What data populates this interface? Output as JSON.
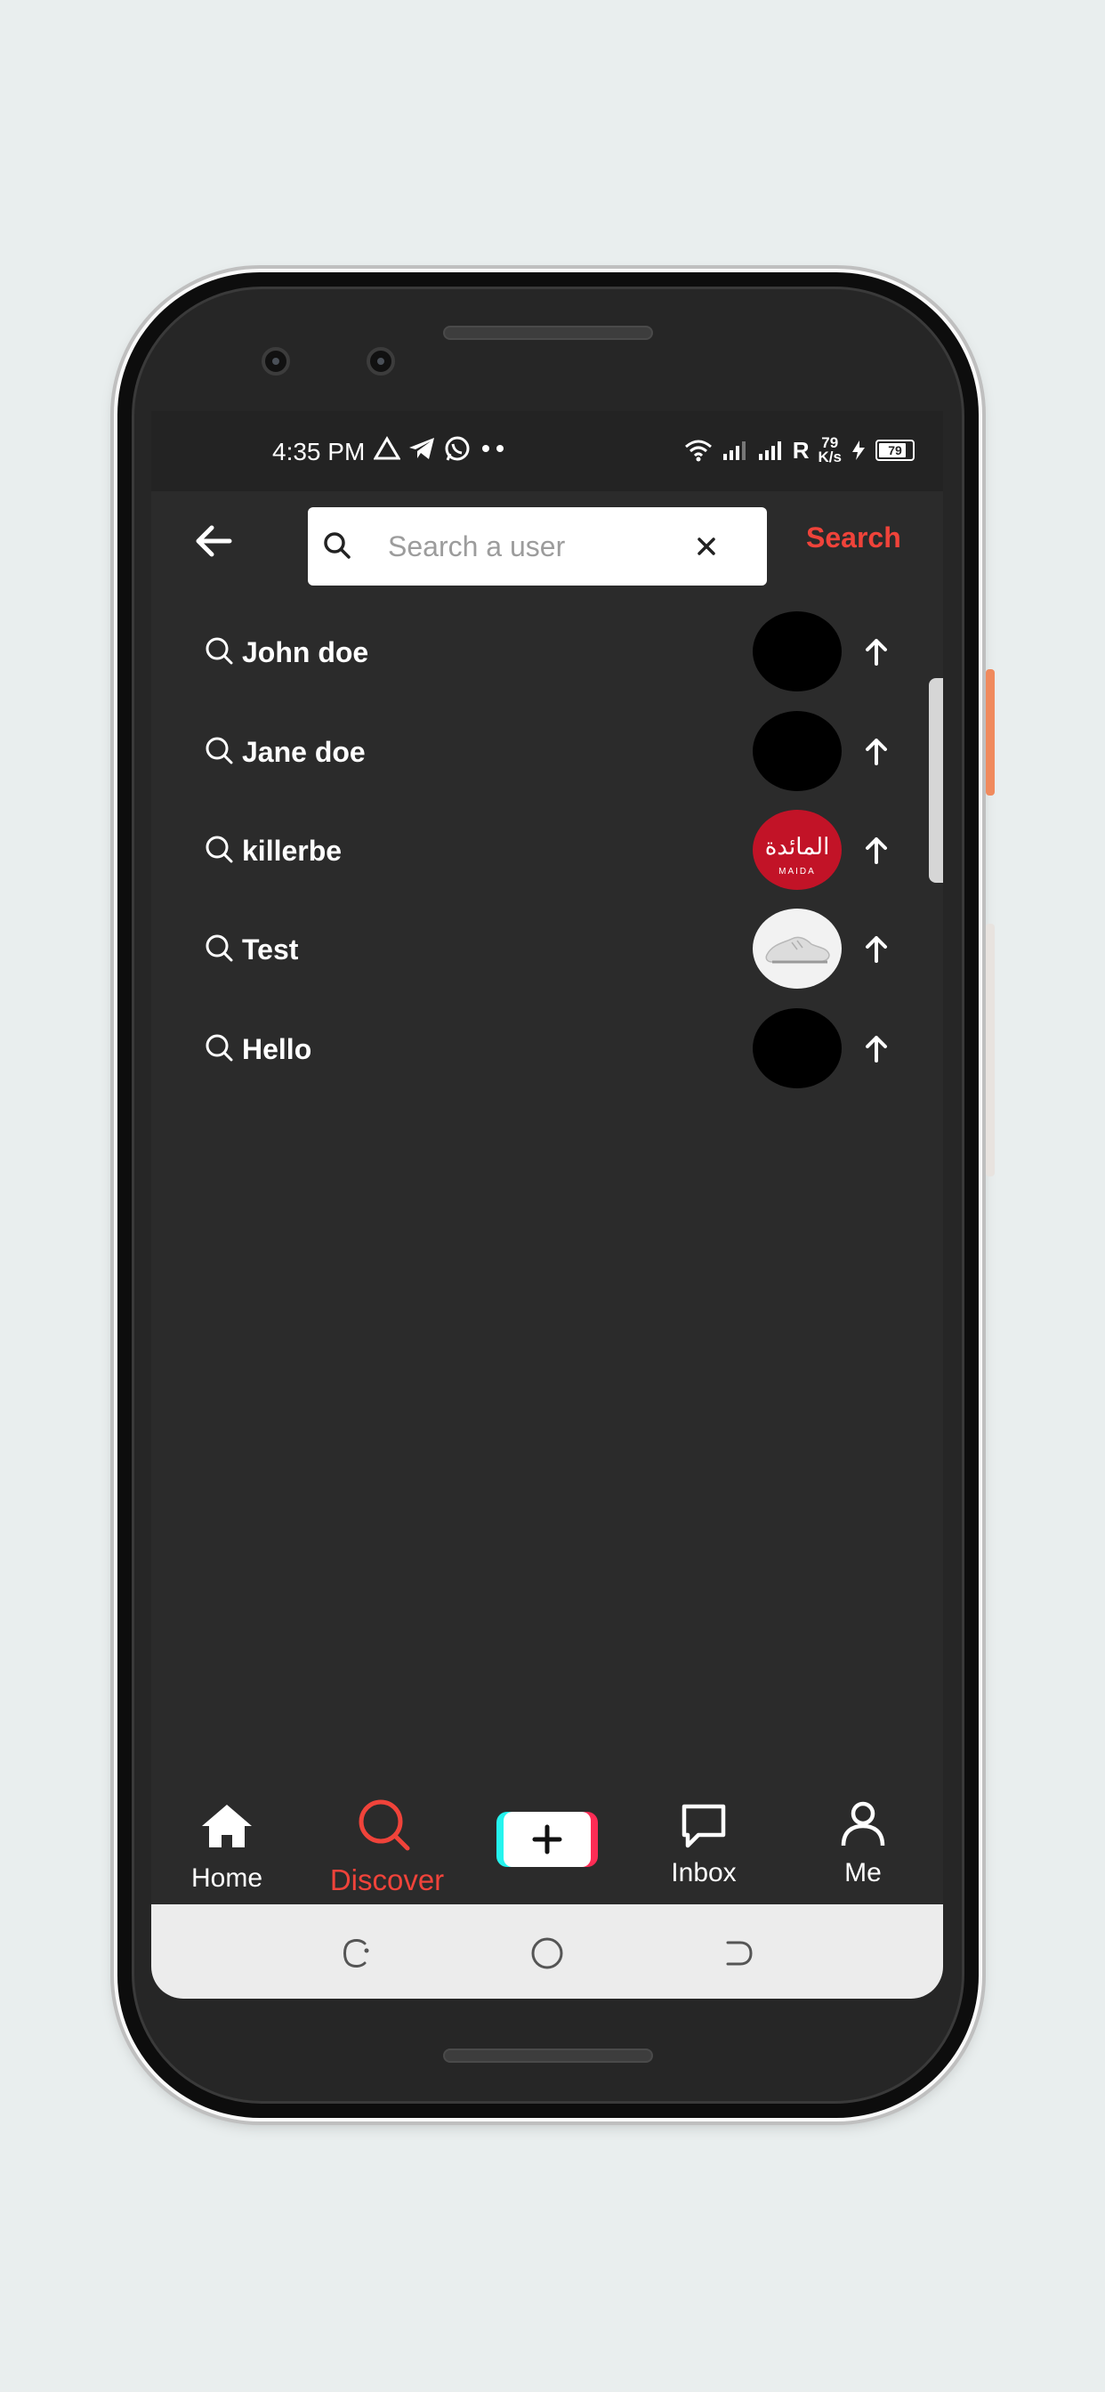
{
  "status_bar": {
    "time": "4:35 PM",
    "icons": [
      "warning-triangle-icon",
      "telegram-icon",
      "whatsapp-icon",
      "more-dots-icon"
    ],
    "network_label": "R",
    "speed_value": "79",
    "speed_unit": "K/s",
    "battery": "79"
  },
  "search": {
    "placeholder": "Search a user",
    "value": "",
    "submit_label": "Search"
  },
  "suggestions": [
    {
      "label": "John doe",
      "avatar": "black"
    },
    {
      "label": "Jane doe",
      "avatar": "black"
    },
    {
      "label": "killerbe",
      "avatar": "red-logo"
    },
    {
      "label": "Test",
      "avatar": "sneaker-photo"
    },
    {
      "label": "Hello",
      "avatar": "black"
    }
  ],
  "bottom_nav": {
    "home": "Home",
    "discover": "Discover",
    "inbox": "Inbox",
    "me": "Me"
  },
  "avatar_logo_text": "المائدة",
  "avatar_logo_subtext": "MAIDA",
  "colors": {
    "accent": "#f0433a",
    "background": "#2b2b2b",
    "tiktok_cyan": "#25f4ee",
    "tiktok_pink": "#fe2c55"
  }
}
